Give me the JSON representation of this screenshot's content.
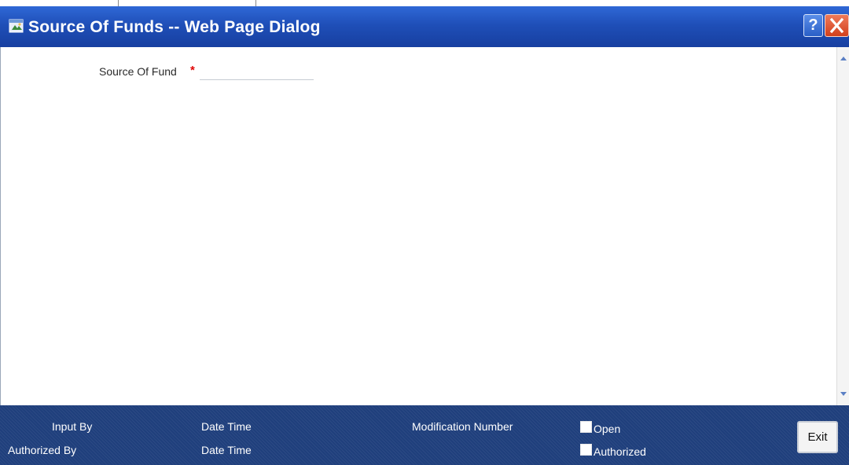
{
  "window": {
    "title": "Source Of Funds -- Web Page Dialog",
    "help_icon": "?",
    "close_icon": "close-icon"
  },
  "form": {
    "source_of_fund_label": "Source Of Fund",
    "required_marker": "*",
    "source_of_fund_value": ""
  },
  "footer": {
    "input_by_label": "Input By",
    "authorized_by_label": "Authorized By",
    "date_time_label_1": "Date Time",
    "date_time_label_2": "Date Time",
    "modification_number_label": "Modification Number",
    "open_label": "Open",
    "authorized_label": "Authorized",
    "exit_label": "Exit"
  },
  "colors": {
    "titlebar": "#1f4fb8",
    "footer": "#1f3f7c",
    "required": "#e00000"
  }
}
